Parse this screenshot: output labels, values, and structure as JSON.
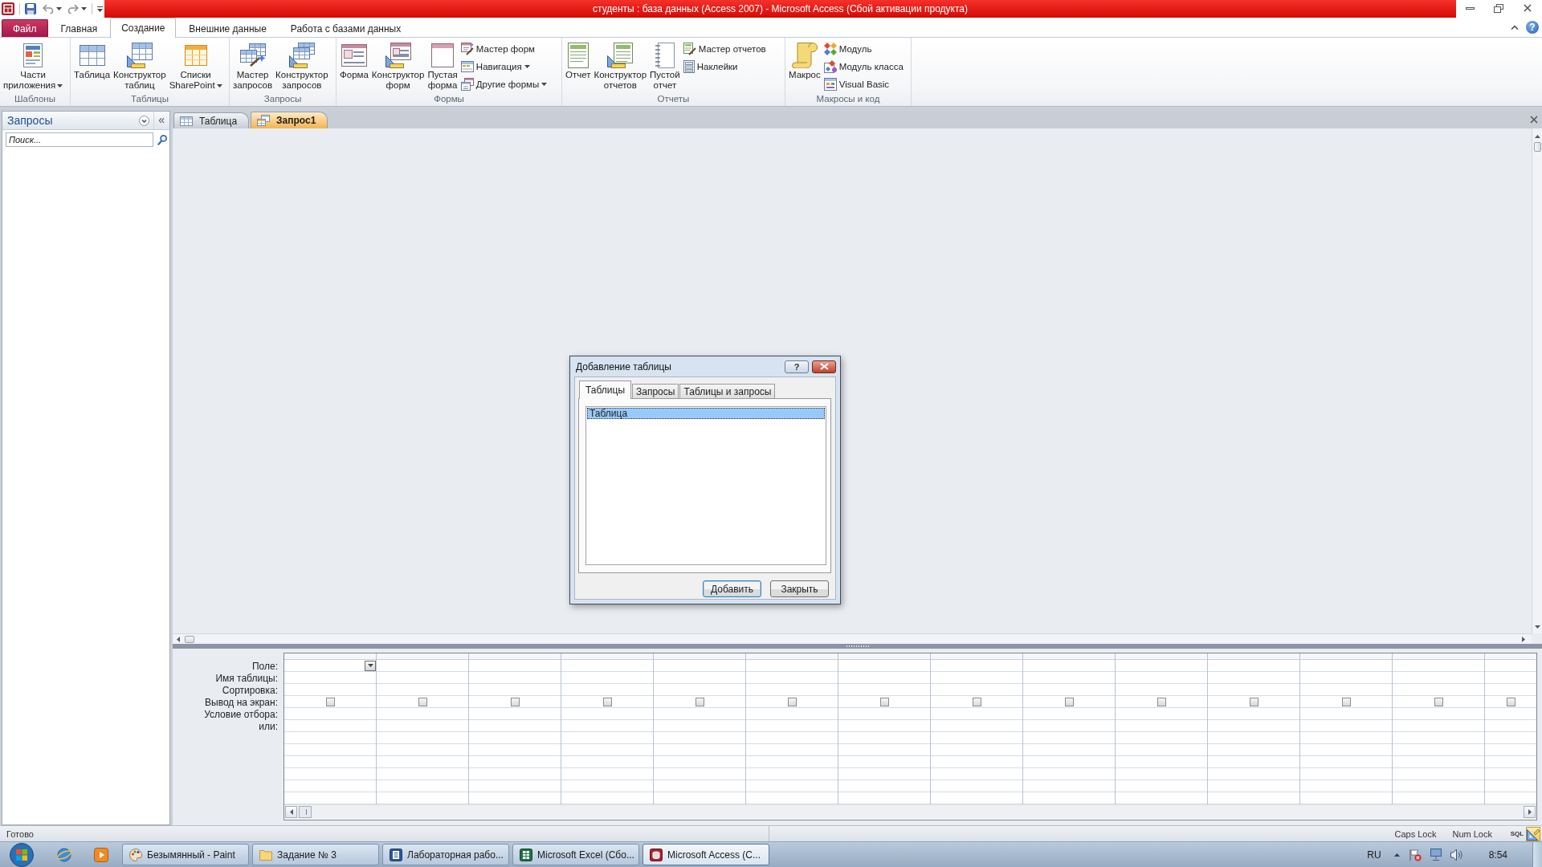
{
  "title_bar": {
    "title": "студенты : база данных (Access 2007) - Microsoft Access (Сбой активации продукта)"
  },
  "ribbon": {
    "tabs": [
      {
        "kind": "menu",
        "label": "Файл",
        "selected": false
      },
      {
        "kind": "tab",
        "label": "Главная",
        "selected": false
      },
      {
        "kind": "tab",
        "label": "Создание",
        "selected": true
      },
      {
        "kind": "tab",
        "label": "Внешние данные",
        "selected": false
      },
      {
        "kind": "tab",
        "label": "Работа с базами данных",
        "selected": false
      }
    ],
    "help": "?",
    "groups": [
      {
        "label": "Шаблоны",
        "buttons": [
          {
            "kind": "large",
            "label": "Части\nприложения",
            "dropdown": true
          }
        ]
      },
      {
        "label": "Таблицы",
        "buttons": [
          {
            "kind": "large",
            "label": "Таблица",
            "dropdown": false
          },
          {
            "kind": "large",
            "label": "Конструктор\nтаблиц",
            "dropdown": false
          },
          {
            "kind": "large",
            "label": "Списки\nSharePoint",
            "dropdown": true
          }
        ]
      },
      {
        "label": "Запросы",
        "buttons": [
          {
            "kind": "large",
            "label": "Мастер\nзапросов",
            "dropdown": false
          },
          {
            "kind": "large",
            "label": "Конструктор\nзапросов",
            "dropdown": false
          }
        ]
      },
      {
        "label": "Формы",
        "buttons": [
          {
            "kind": "large",
            "label": "Форма",
            "dropdown": false
          },
          {
            "kind": "large",
            "label": "Конструктор\nформ",
            "dropdown": false
          },
          {
            "kind": "large",
            "label": "Пустая\nформа",
            "dropdown": false
          },
          {
            "kind": "small",
            "label": "Мастер форм",
            "dropdown": false
          },
          {
            "kind": "small",
            "label": "Навигация",
            "dropdown": true
          },
          {
            "kind": "small",
            "label": "Другие формы",
            "dropdown": true
          }
        ]
      },
      {
        "label": "Отчеты",
        "buttons": [
          {
            "kind": "large",
            "label": "Отчет",
            "dropdown": false
          },
          {
            "kind": "large",
            "label": "Конструктор\nотчетов",
            "dropdown": false
          },
          {
            "kind": "large",
            "label": "Пустой\nотчет",
            "dropdown": false
          },
          {
            "kind": "small",
            "label": "Мастер отчетов",
            "dropdown": false
          },
          {
            "kind": "small",
            "label": "Наклейки",
            "dropdown": false
          }
        ]
      },
      {
        "label": "Макросы и код",
        "buttons": [
          {
            "kind": "large",
            "label": "Макрос",
            "dropdown": false
          },
          {
            "kind": "small",
            "label": "Модуль",
            "dropdown": false
          },
          {
            "kind": "small",
            "label": "Модуль класса",
            "dropdown": false
          },
          {
            "kind": "small",
            "label": "Visual Basic",
            "dropdown": false
          }
        ]
      }
    ]
  },
  "nav_pane": {
    "title": "Запросы",
    "collapse": "«",
    "search": {
      "placeholder": "Поиск..."
    }
  },
  "document_tabs": [
    {
      "label": "Таблица",
      "selected": false
    },
    {
      "label": "Запрос1",
      "selected": true
    }
  ],
  "dialog": {
    "title": "Добавление таблицы",
    "help": "?",
    "tabs": [
      {
        "label": "Таблицы",
        "selected": true
      },
      {
        "label": "Запросы",
        "selected": false
      },
      {
        "label": "Таблицы и запросы",
        "selected": false
      }
    ],
    "items": [
      {
        "label": "Таблица",
        "selected": true
      }
    ],
    "buttons": [
      {
        "label": "Добавить",
        "default": true
      },
      {
        "label": "Закрыть",
        "default": false
      }
    ]
  },
  "query_grid": {
    "row_labels": [
      "Поле:",
      "Имя таблицы:",
      "Сортировка:",
      "Вывод на экран:",
      "Условие отбора:",
      "или:"
    ],
    "columns": [
      {
        "active": true,
        "checked": false
      },
      {
        "active": false,
        "checked": false
      },
      {
        "active": false,
        "checked": false
      },
      {
        "active": false,
        "checked": false
      },
      {
        "active": false,
        "checked": false
      },
      {
        "active": false,
        "checked": false
      },
      {
        "active": false,
        "checked": false
      },
      {
        "active": false,
        "checked": false
      },
      {
        "active": false,
        "checked": false
      },
      {
        "active": false,
        "checked": false
      },
      {
        "active": false,
        "checked": false
      },
      {
        "active": false,
        "checked": false
      },
      {
        "active": false,
        "checked": false
      },
      {
        "active": false,
        "checked": false
      }
    ]
  },
  "status_bar": {
    "message": "Готово",
    "indicators": [
      "Caps Lock",
      "Num Lock"
    ],
    "view_buttons": [
      {
        "kind": "text",
        "label": "SQL",
        "selected": false
      },
      {
        "kind": "icon",
        "selected": true
      }
    ]
  },
  "taskbar": {
    "windows": [
      {
        "label": "Безымянный - Paint",
        "selected": false
      },
      {
        "label": "Задание № 3",
        "selected": false
      },
      {
        "label": "Лабораторная рабо...",
        "selected": false
      },
      {
        "label": "Microsoft Excel (Сбо...",
        "selected": false
      },
      {
        "label": "Microsoft Access (С...",
        "selected": true
      }
    ],
    "language": "RU",
    "clock": "8:54"
  }
}
